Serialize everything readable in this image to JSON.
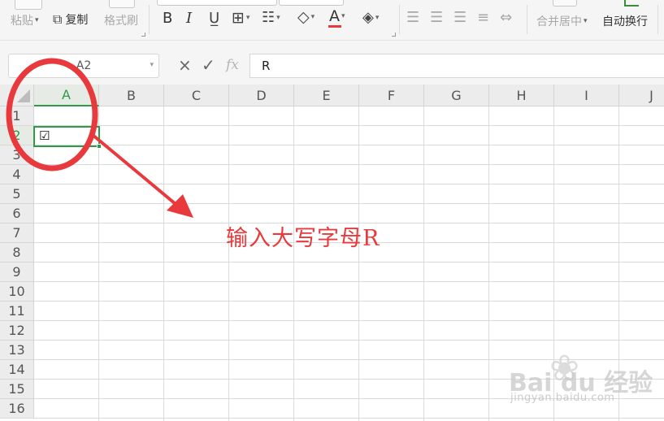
{
  "toolbar": {
    "paste_label": "粘贴",
    "copy_label": "复制",
    "format_painter_label": "格式刷",
    "bold": "B",
    "italic": "I",
    "font_color_letter": "A",
    "merge_center_label": "合并居中",
    "wrap_text_label": "自动换行",
    "colors": {
      "font_color_bar": "#e8393c"
    }
  },
  "formula_bar": {
    "name_box_value": "A2",
    "cancel_icon": "×",
    "confirm_icon": "✓",
    "fx_label": "fx",
    "formula_value": "R"
  },
  "grid": {
    "columns": [
      "A",
      "B",
      "C",
      "D",
      "E",
      "F",
      "G",
      "H",
      "I",
      "J"
    ],
    "rows": [
      "1",
      "2",
      "3",
      "4",
      "5",
      "6",
      "7",
      "8",
      "9",
      "10",
      "11",
      "12",
      "13",
      "14",
      "15",
      "16"
    ],
    "active_column": "A",
    "active_row": "2",
    "active_cell_value": "☑"
  },
  "annotation": {
    "text": "输入大写字母R",
    "color": "#e8393c"
  },
  "watermark": {
    "logo": "Bai  du 经验",
    "url": "jingyan.baidu.com"
  }
}
